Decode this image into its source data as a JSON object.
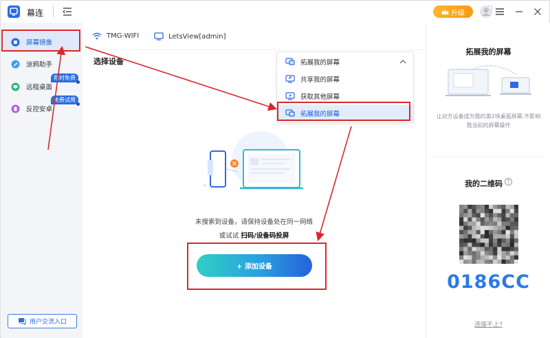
{
  "app": {
    "title": "幕连"
  },
  "titlebar": {
    "upgrade_label": "升级"
  },
  "sidebar": {
    "items": [
      {
        "label": "屏幕镜像",
        "active": true
      },
      {
        "label": "涂鸦助手"
      },
      {
        "label": "远程桌面",
        "badge": "限时免费"
      },
      {
        "label": "反控安卓",
        "badge": "免费试用"
      }
    ],
    "feedback_label": "用户交流入口"
  },
  "network": {
    "wifi": "TMG-WIFI",
    "device": "LetsView[admin]"
  },
  "main": {
    "section_title": "选择设备",
    "dropdown": {
      "selected": "拓展我的屏幕",
      "options": [
        "共享我的屏幕",
        "获取其他屏幕",
        "拓展我的屏幕"
      ]
    },
    "message_line1": "未搜索到设备，请保持设备处在同一网络",
    "message_line2_prefix": "或试试",
    "message_line2_link": "扫码/设备码投屏",
    "add_button": "+ 添加设备"
  },
  "right_panel": {
    "title": "拓展我的屏幕",
    "description": "让对方设备成为我的第2块桌面屏幕,不影响我当前的屏幕操作",
    "qr_title": "我的二维码",
    "help": "?",
    "code": "0186CC",
    "cant_connect": "连接不上?"
  },
  "colors": {
    "accent": "#2a6be3",
    "annotation_red": "#d8272b",
    "upgrade": "#f5a01a"
  }
}
